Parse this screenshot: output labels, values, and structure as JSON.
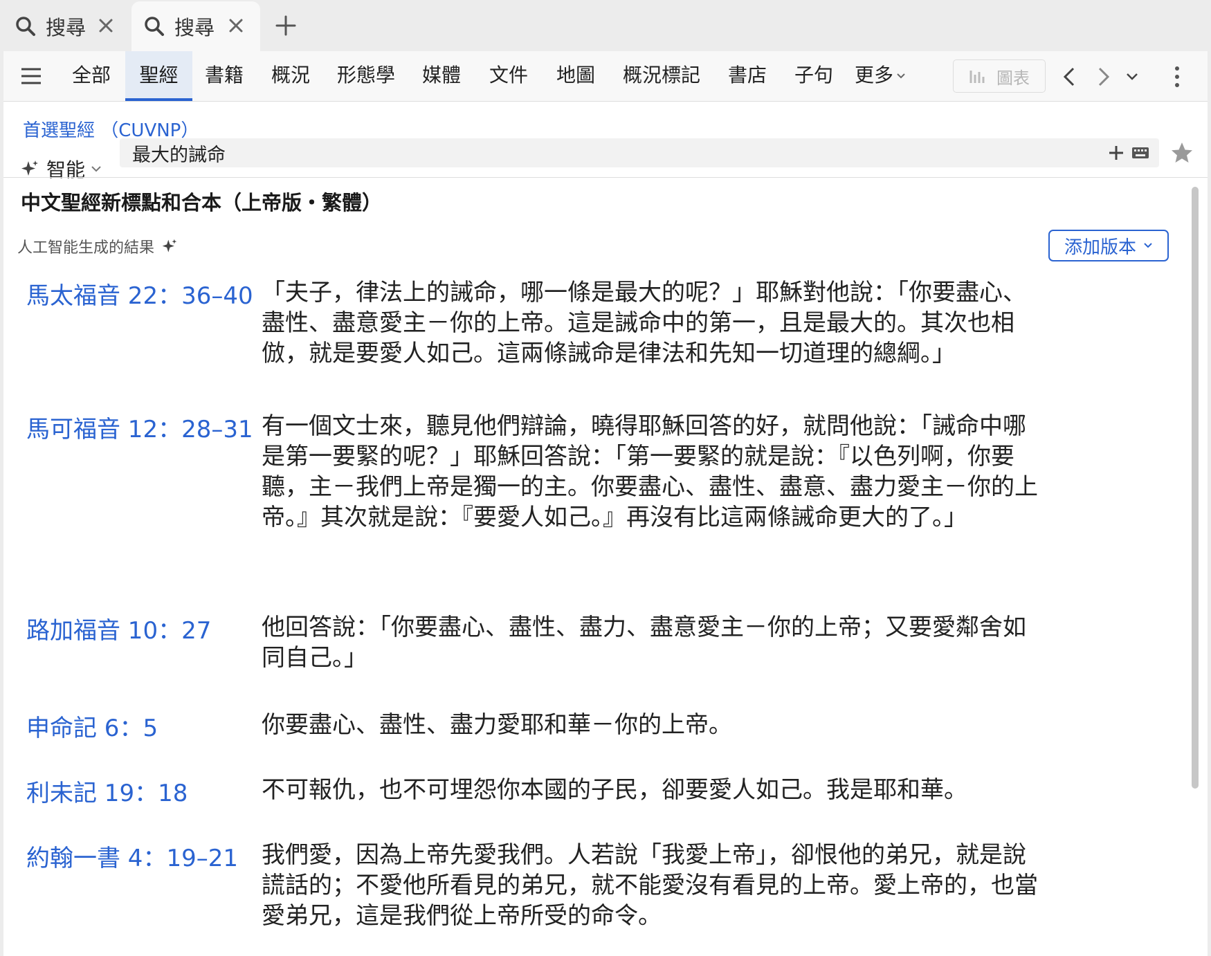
{
  "tabs": [
    {
      "label": "搜尋",
      "icon": "search-icon"
    },
    {
      "label": "搜尋",
      "icon": "search-icon"
    }
  ],
  "nav": {
    "items": [
      "全部",
      "聖經",
      "書籍",
      "概況",
      "形態學",
      "媒體",
      "文件",
      "地圖",
      "概況標記",
      "書店",
      "子句"
    ],
    "more": "更多",
    "active": "聖經",
    "chart_label": "圖表"
  },
  "search": {
    "preferred_bible": "首選聖經 （CUVNP）",
    "mode": "智能",
    "query": "最大的誡命"
  },
  "results": {
    "version_title": "中文聖經新標點和合本（上帝版・繁體）",
    "ai_label": "人工智能生成的結果",
    "add_version": "添加版本",
    "items": [
      {
        "ref": "馬太福音 22：36–40",
        "text": "「夫子，律法上的誡命，哪一條是最大的呢？」耶穌對他說：「你要盡心、盡性、盡意愛主－你的上帝。這是誡命中的第一，且是最大的。其次也相倣，就是要愛人如己。這兩條誡命是律法和先知一切道理的總綱。」"
      },
      {
        "ref": "馬可福音 12：28–31",
        "text": "有一個文士來，聽見他們辯論，曉得耶穌回答的好，就問他說：「誡命中哪是第一要緊的呢？」耶穌回答說：「第一要緊的就是說：『以色列啊，你要聽，主－我們上帝是獨一的主。你要盡心、盡性、盡意、盡力愛主－你的上帝。』其次就是說：『要愛人如己。』再沒有比這兩條誡命更大的了。」"
      },
      {
        "ref": "路加福音 10：27",
        "text": "他回答說：「你要盡心、盡性、盡力、盡意愛主－你的上帝；又要愛鄰舍如同自己。」"
      },
      {
        "ref": "申命記 6：5",
        "text": "你要盡心、盡性、盡力愛耶和華－你的上帝。"
      },
      {
        "ref": "利未記 19：18",
        "text": "不可報仇，也不可埋怨你本國的子民，卻要愛人如己。我是耶和華。"
      },
      {
        "ref": "約翰一書 4：19–21",
        "text": "我們愛，因為上帝先愛我們。人若說「我愛上帝」，卻恨他的弟兄，就是說謊話的；不愛他所看見的弟兄，就不能愛沒有看見的上帝。愛上帝的，也當愛弟兄，這是我們從上帝所受的命令。"
      }
    ]
  },
  "colors": {
    "accent": "#2a63d1",
    "text": "#222222",
    "tab_bg": "#ececec",
    "nav_bg": "#f8f8f8"
  }
}
